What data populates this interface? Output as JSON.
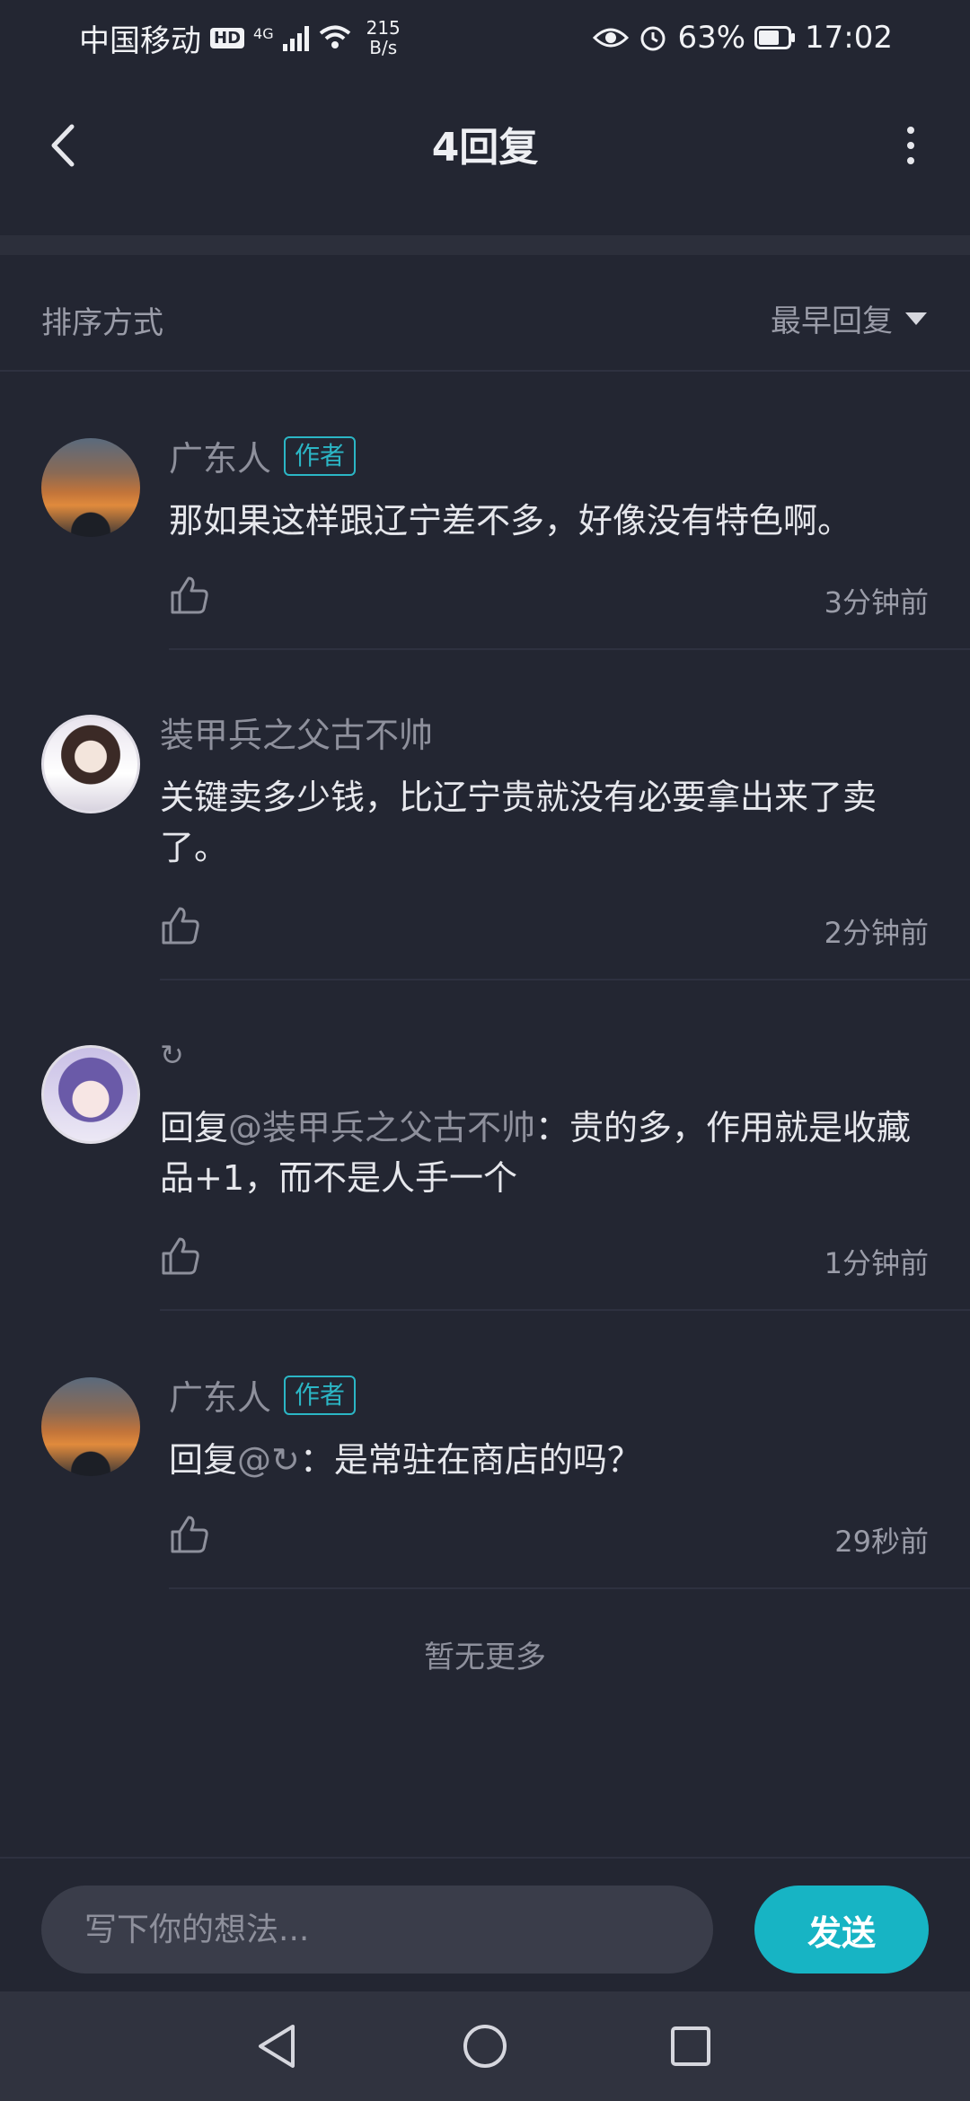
{
  "status_bar": {
    "carrier": "中国移动",
    "hd": "HD",
    "network": "4G",
    "net_speed_value": "215",
    "net_speed_unit": "B/s",
    "battery": "63%",
    "time": "17:02"
  },
  "header": {
    "title": "4回复"
  },
  "sort": {
    "label": "排序方式",
    "selected": "最早回复"
  },
  "comments": [
    {
      "username": "广东人",
      "badge": "作者",
      "content": "那如果这样跟辽宁差不多，好像没有特色啊。",
      "time": "3分钟前"
    },
    {
      "username": "装甲兵之父古不帅",
      "content": "关键卖多少钱，比辽宁贵就没有必要拿出来了卖了。",
      "time": "2分钟前"
    },
    {
      "username": "↻",
      "reply_prefix": "回复",
      "reply_mention": "@装甲兵之父古不帅",
      "reply_text": "：贵的多，作用就是收藏品+1，而不是人手一个",
      "time": "1分钟前"
    },
    {
      "username": "广东人",
      "badge": "作者",
      "reply_prefix": "回复",
      "reply_mention": "@↻",
      "reply_text": "：是常驻在商店的吗？",
      "time": "29秒前"
    }
  ],
  "footer_note": "暂无更多",
  "composer": {
    "placeholder": "写下你的想法...",
    "send_label": "发送"
  },
  "colors": {
    "background": "#232632",
    "accent": "#17b4c4",
    "author_badge": "#2bb6c5"
  }
}
